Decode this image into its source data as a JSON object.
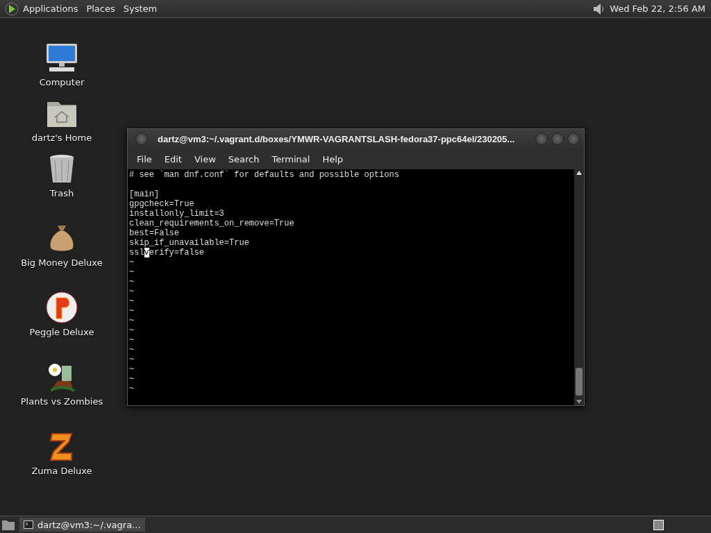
{
  "top_panel": {
    "menus": [
      "Applications",
      "Places",
      "System"
    ],
    "clock": "Wed Feb 22,  2:56 AM"
  },
  "desktop_icons": [
    {
      "kind": "computer",
      "label": "Computer"
    },
    {
      "kind": "home",
      "label": "dartz's Home"
    },
    {
      "kind": "trash",
      "label": "Trash"
    },
    {
      "kind": "money",
      "label": "Big Money Deluxe"
    },
    {
      "kind": "peggle",
      "label": "Peggle Deluxe"
    },
    {
      "kind": "plants",
      "label": "Plants vs Zombies"
    },
    {
      "kind": "zuma",
      "label": "Zuma Deluxe"
    }
  ],
  "terminal": {
    "title": "dartz@vm3:~/.vagrant.d/boxes/YMWR-VAGRANTSLASH-fedora37-ppc64el/230205...",
    "menu": [
      "File",
      "Edit",
      "View",
      "Search",
      "Terminal",
      "Help"
    ],
    "lines": [
      {
        "kind": "text",
        "text": "# see `man dnf.conf` for defaults and possible options"
      },
      {
        "kind": "blank"
      },
      {
        "kind": "text",
        "text": "[main]"
      },
      {
        "kind": "text",
        "text": "gpgcheck=True"
      },
      {
        "kind": "text",
        "text": "installonly_limit=3"
      },
      {
        "kind": "text",
        "text": "clean_requirements_on_remove=True"
      },
      {
        "kind": "text",
        "text": "best=False"
      },
      {
        "kind": "text",
        "text": "skip_if_unavailable=True"
      },
      {
        "kind": "cursor",
        "before": "ssl",
        "cursor": "v",
        "after": "erify=false"
      },
      {
        "kind": "text",
        "text": "~"
      },
      {
        "kind": "text",
        "text": "~"
      },
      {
        "kind": "text",
        "text": "~"
      },
      {
        "kind": "text",
        "text": "~"
      },
      {
        "kind": "text",
        "text": "~"
      },
      {
        "kind": "text",
        "text": "~"
      },
      {
        "kind": "text",
        "text": "~"
      },
      {
        "kind": "text",
        "text": "~"
      },
      {
        "kind": "text",
        "text": "~"
      },
      {
        "kind": "text",
        "text": "~"
      },
      {
        "kind": "text",
        "text": "~"
      },
      {
        "kind": "text",
        "text": "~"
      },
      {
        "kind": "text",
        "text": "~"
      },
      {
        "kind": "text",
        "text": "~"
      }
    ]
  },
  "taskbar": {
    "tasks": [
      {
        "label": "dartz@vm3:~/.vagra...",
        "selected": true
      }
    ]
  }
}
